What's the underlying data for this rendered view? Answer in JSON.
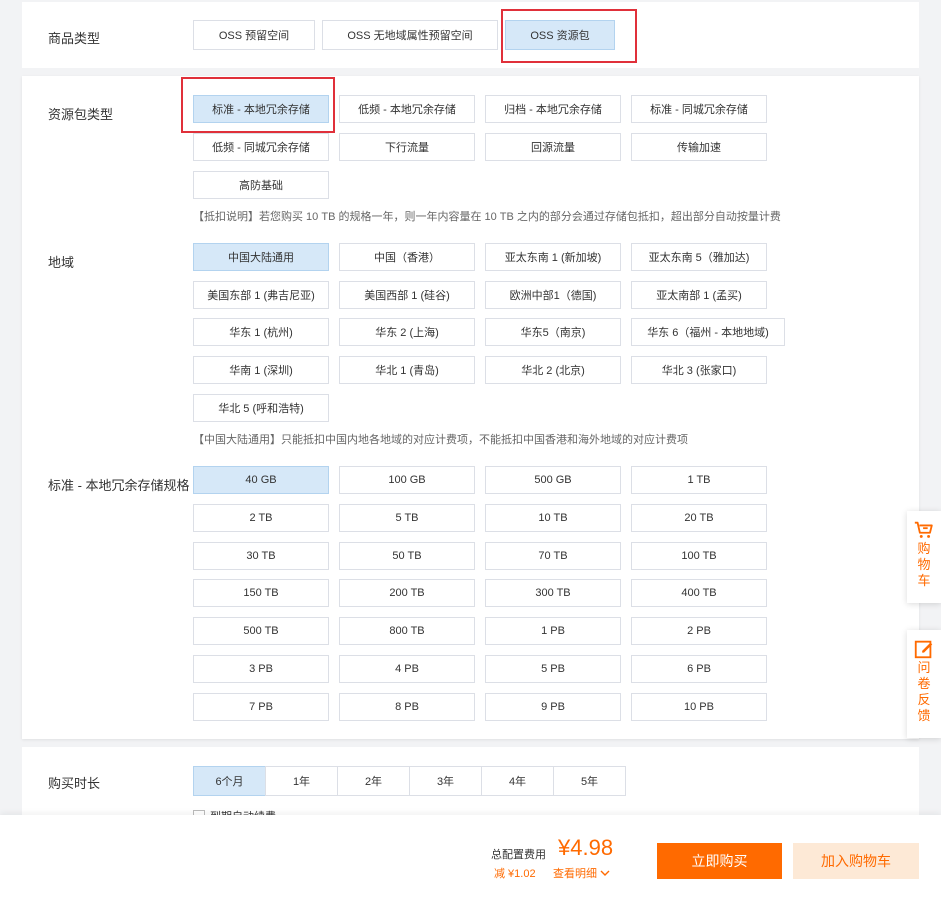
{
  "product_type": {
    "label": "商品类型",
    "options": [
      "OSS 预留空间",
      "OSS 无地域属性预留空间",
      "OSS 资源包"
    ]
  },
  "package_type": {
    "label": "资源包类型",
    "options": [
      "标准 - 本地冗余存储",
      "低频 - 本地冗余存储",
      "归档 - 本地冗余存储",
      "标准 - 同城冗余存储",
      "低频 - 同城冗余存储",
      "下行流量",
      "回源流量",
      "传输加速",
      "高防基础"
    ],
    "note": "【抵扣说明】若您购买 10 TB 的规格一年，则一年内容量在 10 TB 之内的部分会通过存储包抵扣，超出部分自动按量计费"
  },
  "region": {
    "label": "地域",
    "options": [
      "中国大陆通用",
      "中国（香港）",
      "亚太东南 1 (新加坡)",
      "亚太东南 5（雅加达)",
      "美国东部 1 (弗吉尼亚)",
      "美国西部 1 (硅谷)",
      "欧洲中部1（德国)",
      "亚太南部 1 (孟买)",
      "华东 1 (杭州)",
      "华东 2 (上海)",
      "华东5（南京)",
      "华东 6（福州 - 本地地域)",
      "华南 1 (深圳)",
      "华北 1 (青岛)",
      "华北 2 (北京)",
      "华北 3 (张家口)",
      "华北 5 (呼和浩特)"
    ],
    "note": "【中国大陆通用】只能抵扣中国内地各地域的对应计费项，不能抵扣中国香港和海外地域的对应计费项"
  },
  "spec": {
    "label": "标准 - 本地冗余存储规格",
    "options": [
      "40 GB",
      "100 GB",
      "500 GB",
      "1 TB",
      "2 TB",
      "5 TB",
      "10 TB",
      "20 TB",
      "30 TB",
      "50 TB",
      "70 TB",
      "100 TB",
      "150 TB",
      "200 TB",
      "300 TB",
      "400 TB",
      "500 TB",
      "800 TB",
      "1 PB",
      "2 PB",
      "3 PB",
      "4 PB",
      "5 PB",
      "6 PB",
      "7 PB",
      "8 PB",
      "9 PB",
      "10 PB"
    ]
  },
  "duration": {
    "label": "购买时长",
    "options": [
      "6个月",
      "1年",
      "2年",
      "3年",
      "4年",
      "5年"
    ],
    "auto_renew": "到期自动续费"
  },
  "footer": {
    "total_label": "总配置费用",
    "price": "¥4.98",
    "discount": "减 ¥1.02",
    "details_link": "查看明细",
    "buy_now": "立即购买",
    "add_to_cart": "加入购物车"
  },
  "side": {
    "cart": "购物车",
    "survey": "问卷反馈"
  },
  "colors": {
    "accent": "#ff6a00",
    "selected_bg": "#d6e8f8",
    "highlight_box": "#e0303a"
  }
}
